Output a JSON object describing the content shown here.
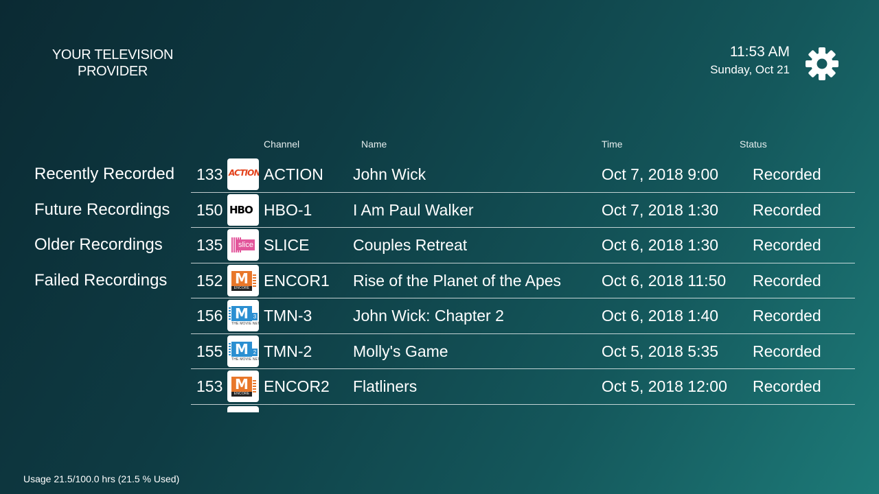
{
  "brand": {
    "line1": "YOUR TELEVISION",
    "line2": "PROVIDER"
  },
  "clock": {
    "time": "11:53 AM",
    "date": "Sunday, Oct 21"
  },
  "settings": {
    "icon": "gear-icon"
  },
  "sidebar": {
    "items": [
      {
        "label": "Recently Recorded"
      },
      {
        "label": "Future Recordings"
      },
      {
        "label": "Older Recordings"
      },
      {
        "label": "Failed Recordings"
      }
    ]
  },
  "table": {
    "headers": {
      "channel": "Channel",
      "name": "Name",
      "time": "Time",
      "status": "Status"
    },
    "rows": [
      {
        "number": "133",
        "logo": "action",
        "logo_text": "ACTION",
        "channel": "ACTION",
        "name": "John Wick",
        "time": "Oct 7, 2018 9:00",
        "status": "Recorded"
      },
      {
        "number": "150",
        "logo": "hbo",
        "logo_text": "HBO",
        "channel": "HBO-1",
        "name": "I Am Paul Walker",
        "time": "Oct 7, 2018 1:30",
        "status": "Recorded"
      },
      {
        "number": "135",
        "logo": "slice",
        "logo_text": "slice",
        "channel": "SLICE",
        "name": "Couples Retreat",
        "time": "Oct 6, 2018 1:30",
        "status": "Recorded"
      },
      {
        "number": "152",
        "logo": "encore",
        "logo_text": "M",
        "logo_sub": "ENCORE",
        "channel": "ENCOR1",
        "name": "Rise of the Planet of the Apes",
        "time": "Oct 6, 2018 11:50",
        "status": "Recorded"
      },
      {
        "number": "156",
        "logo": "tmn",
        "logo_text": "M",
        "logo_num": "3",
        "logo_sub": "THE MOVIE NETWORK",
        "channel": "TMN-3",
        "name": "John Wick: Chapter 2",
        "time": "Oct 6, 2018 1:40",
        "status": "Recorded"
      },
      {
        "number": "155",
        "logo": "tmn",
        "logo_text": "M",
        "logo_num": "2",
        "logo_sub": "THE MOVIE NETWORK",
        "channel": "TMN-2",
        "name": "Molly's Game",
        "time": "Oct 5, 2018 5:35",
        "status": "Recorded"
      },
      {
        "number": "153",
        "logo": "encore",
        "logo_text": "M",
        "logo_sub": "ENCORE",
        "channel": "ENCOR2",
        "name": "Flatliners",
        "time": "Oct 5, 2018 12:00",
        "status": "Recorded"
      }
    ]
  },
  "usage": {
    "text": "Usage 21.5/100.0 hrs (21.5 % Used)"
  }
}
